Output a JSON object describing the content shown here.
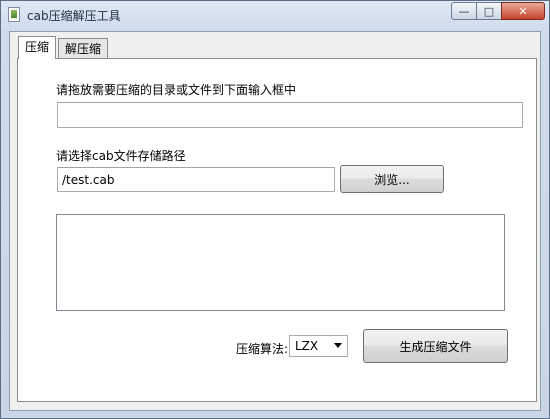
{
  "window": {
    "title": "cab压缩解压工具",
    "controls": {
      "minimize": "—",
      "maximize": "□",
      "close": "✕"
    }
  },
  "tabs": [
    {
      "label": "压缩",
      "active": true
    },
    {
      "label": "解压缩",
      "active": false
    }
  ],
  "compress": {
    "source_label": "请拖放需要压缩的目录或文件到下面输入框中",
    "source_value": "",
    "dest_label": "请选择cab文件存储路径",
    "dest_value": "/test.cab",
    "browse_label": "浏览...",
    "log_text": "",
    "algorithm_label": "压缩算法:",
    "algorithm_value": "LZX",
    "generate_label": "生成压缩文件"
  }
}
